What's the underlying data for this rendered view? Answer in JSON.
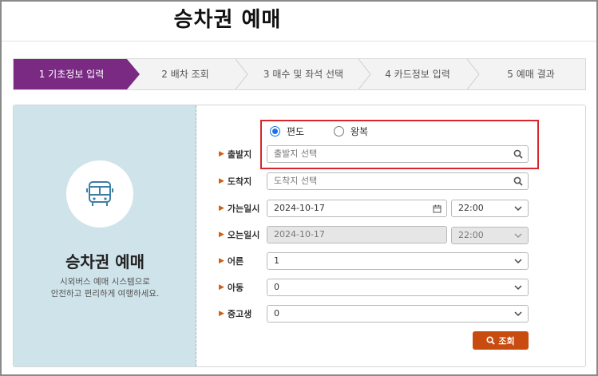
{
  "page": {
    "title": "승차권 예매"
  },
  "steps": [
    {
      "label": "1 기초정보 입력",
      "active": true
    },
    {
      "label": "2 배차 조회",
      "active": false
    },
    {
      "label": "3 매수 및 좌석 선택",
      "active": false
    },
    {
      "label": "4 카드정보 입력",
      "active": false
    },
    {
      "label": "5 예매 결과",
      "active": false
    }
  ],
  "panel": {
    "icon": "bus-icon",
    "title": "승차권 예매",
    "desc_line1": "시외버스 예매 시스템으로",
    "desc_line2": "안전하고 편리하게 여행하세요."
  },
  "form": {
    "trip_type": {
      "oneway": "편도",
      "roundtrip": "왕복",
      "selected": "oneway"
    },
    "departure": {
      "label": "출발지",
      "placeholder": "출발지 선택"
    },
    "arrival": {
      "label": "도착지",
      "placeholder": "도착지 선택"
    },
    "go_datetime": {
      "label": "가는일시",
      "date": "2024-10-17",
      "time": "22:00"
    },
    "return_datetime": {
      "label": "오는일시",
      "date": "2024-10-17",
      "time": "22:00"
    },
    "adult": {
      "label": "어른",
      "value": "1"
    },
    "child": {
      "label": "아동",
      "value": "0"
    },
    "student": {
      "label": "중고생",
      "value": "0"
    },
    "search_button": "조회"
  },
  "colors": {
    "active_step": "#7b2a84",
    "panel_bg": "#cfe3ea",
    "highlight_border": "#d9252c",
    "search_button": "#c84b10"
  }
}
